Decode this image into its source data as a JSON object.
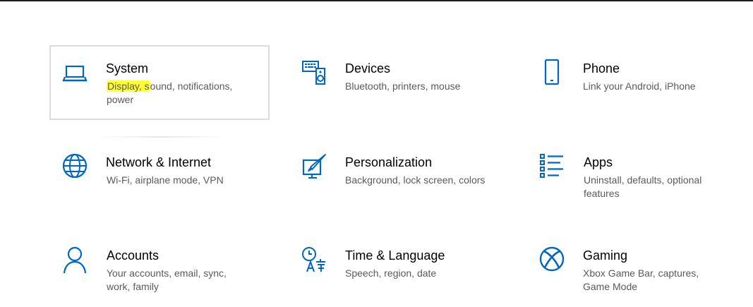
{
  "colors": {
    "accent": "#0067c0",
    "highlight": "#ffff33",
    "text": "#000000",
    "subtext": "#5a5a5a"
  },
  "tiles": [
    {
      "title": "System",
      "desc_highlight": "Display, s",
      "desc_rest": "ound, notifications, power",
      "icon": "laptop-icon"
    },
    {
      "title": "Devices",
      "desc": "Bluetooth, printers, mouse",
      "icon": "keyboard-speaker-icon"
    },
    {
      "title": "Phone",
      "desc": "Link your Android, iPhone",
      "icon": "phone-icon"
    },
    {
      "title": "Network & Internet",
      "desc": "Wi-Fi, airplane mode, VPN",
      "icon": "globe-icon"
    },
    {
      "title": "Personalization",
      "desc": "Background, lock screen, colors",
      "icon": "paint-brush-icon"
    },
    {
      "title": "Apps",
      "desc": "Uninstall, defaults, optional features",
      "icon": "apps-list-icon"
    },
    {
      "title": "Accounts",
      "desc": "Your accounts, email, sync, work, family",
      "icon": "person-icon"
    },
    {
      "title": "Time & Language",
      "desc": "Speech, region, date",
      "icon": "time-language-icon"
    },
    {
      "title": "Gaming",
      "desc": "Xbox Game Bar, captures, Game Mode",
      "icon": "xbox-icon"
    }
  ]
}
